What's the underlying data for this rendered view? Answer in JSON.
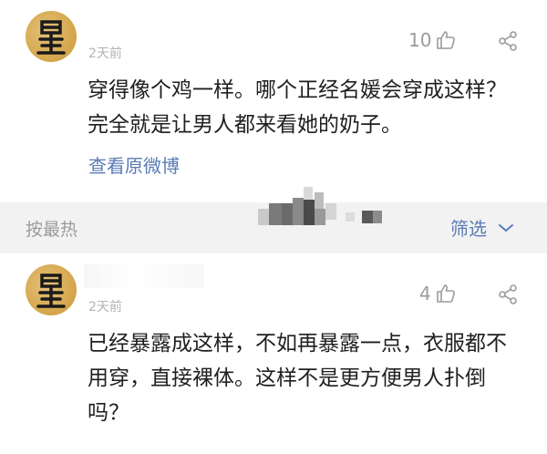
{
  "comments": [
    {
      "time": "2天前",
      "likes": "10",
      "text": "穿得像个鸡一样。哪个正经名媛会穿成这样？完全就是让男人都来看她的奶子。",
      "link": "查看原微博"
    },
    {
      "time": "2天前",
      "likes": "4",
      "text": "已经暴露成这样，不如再暴露一点，衣服都不用穿，直接裸体。这样不是更方便男人扑倒吗？"
    }
  ],
  "sort_bar": {
    "sort_label": "按最热",
    "filter_label": "筛选"
  },
  "icons": {
    "like": "thumbs-up-icon",
    "share": "share-icon",
    "filter": "chevron-down-icon",
    "avatar": "avatar-emblem"
  },
  "colors": {
    "link": "#5a7bb5",
    "meta": "#9b9b9b",
    "divider_bg": "#f2f2f2",
    "avatar_gold": "#d6a950"
  }
}
